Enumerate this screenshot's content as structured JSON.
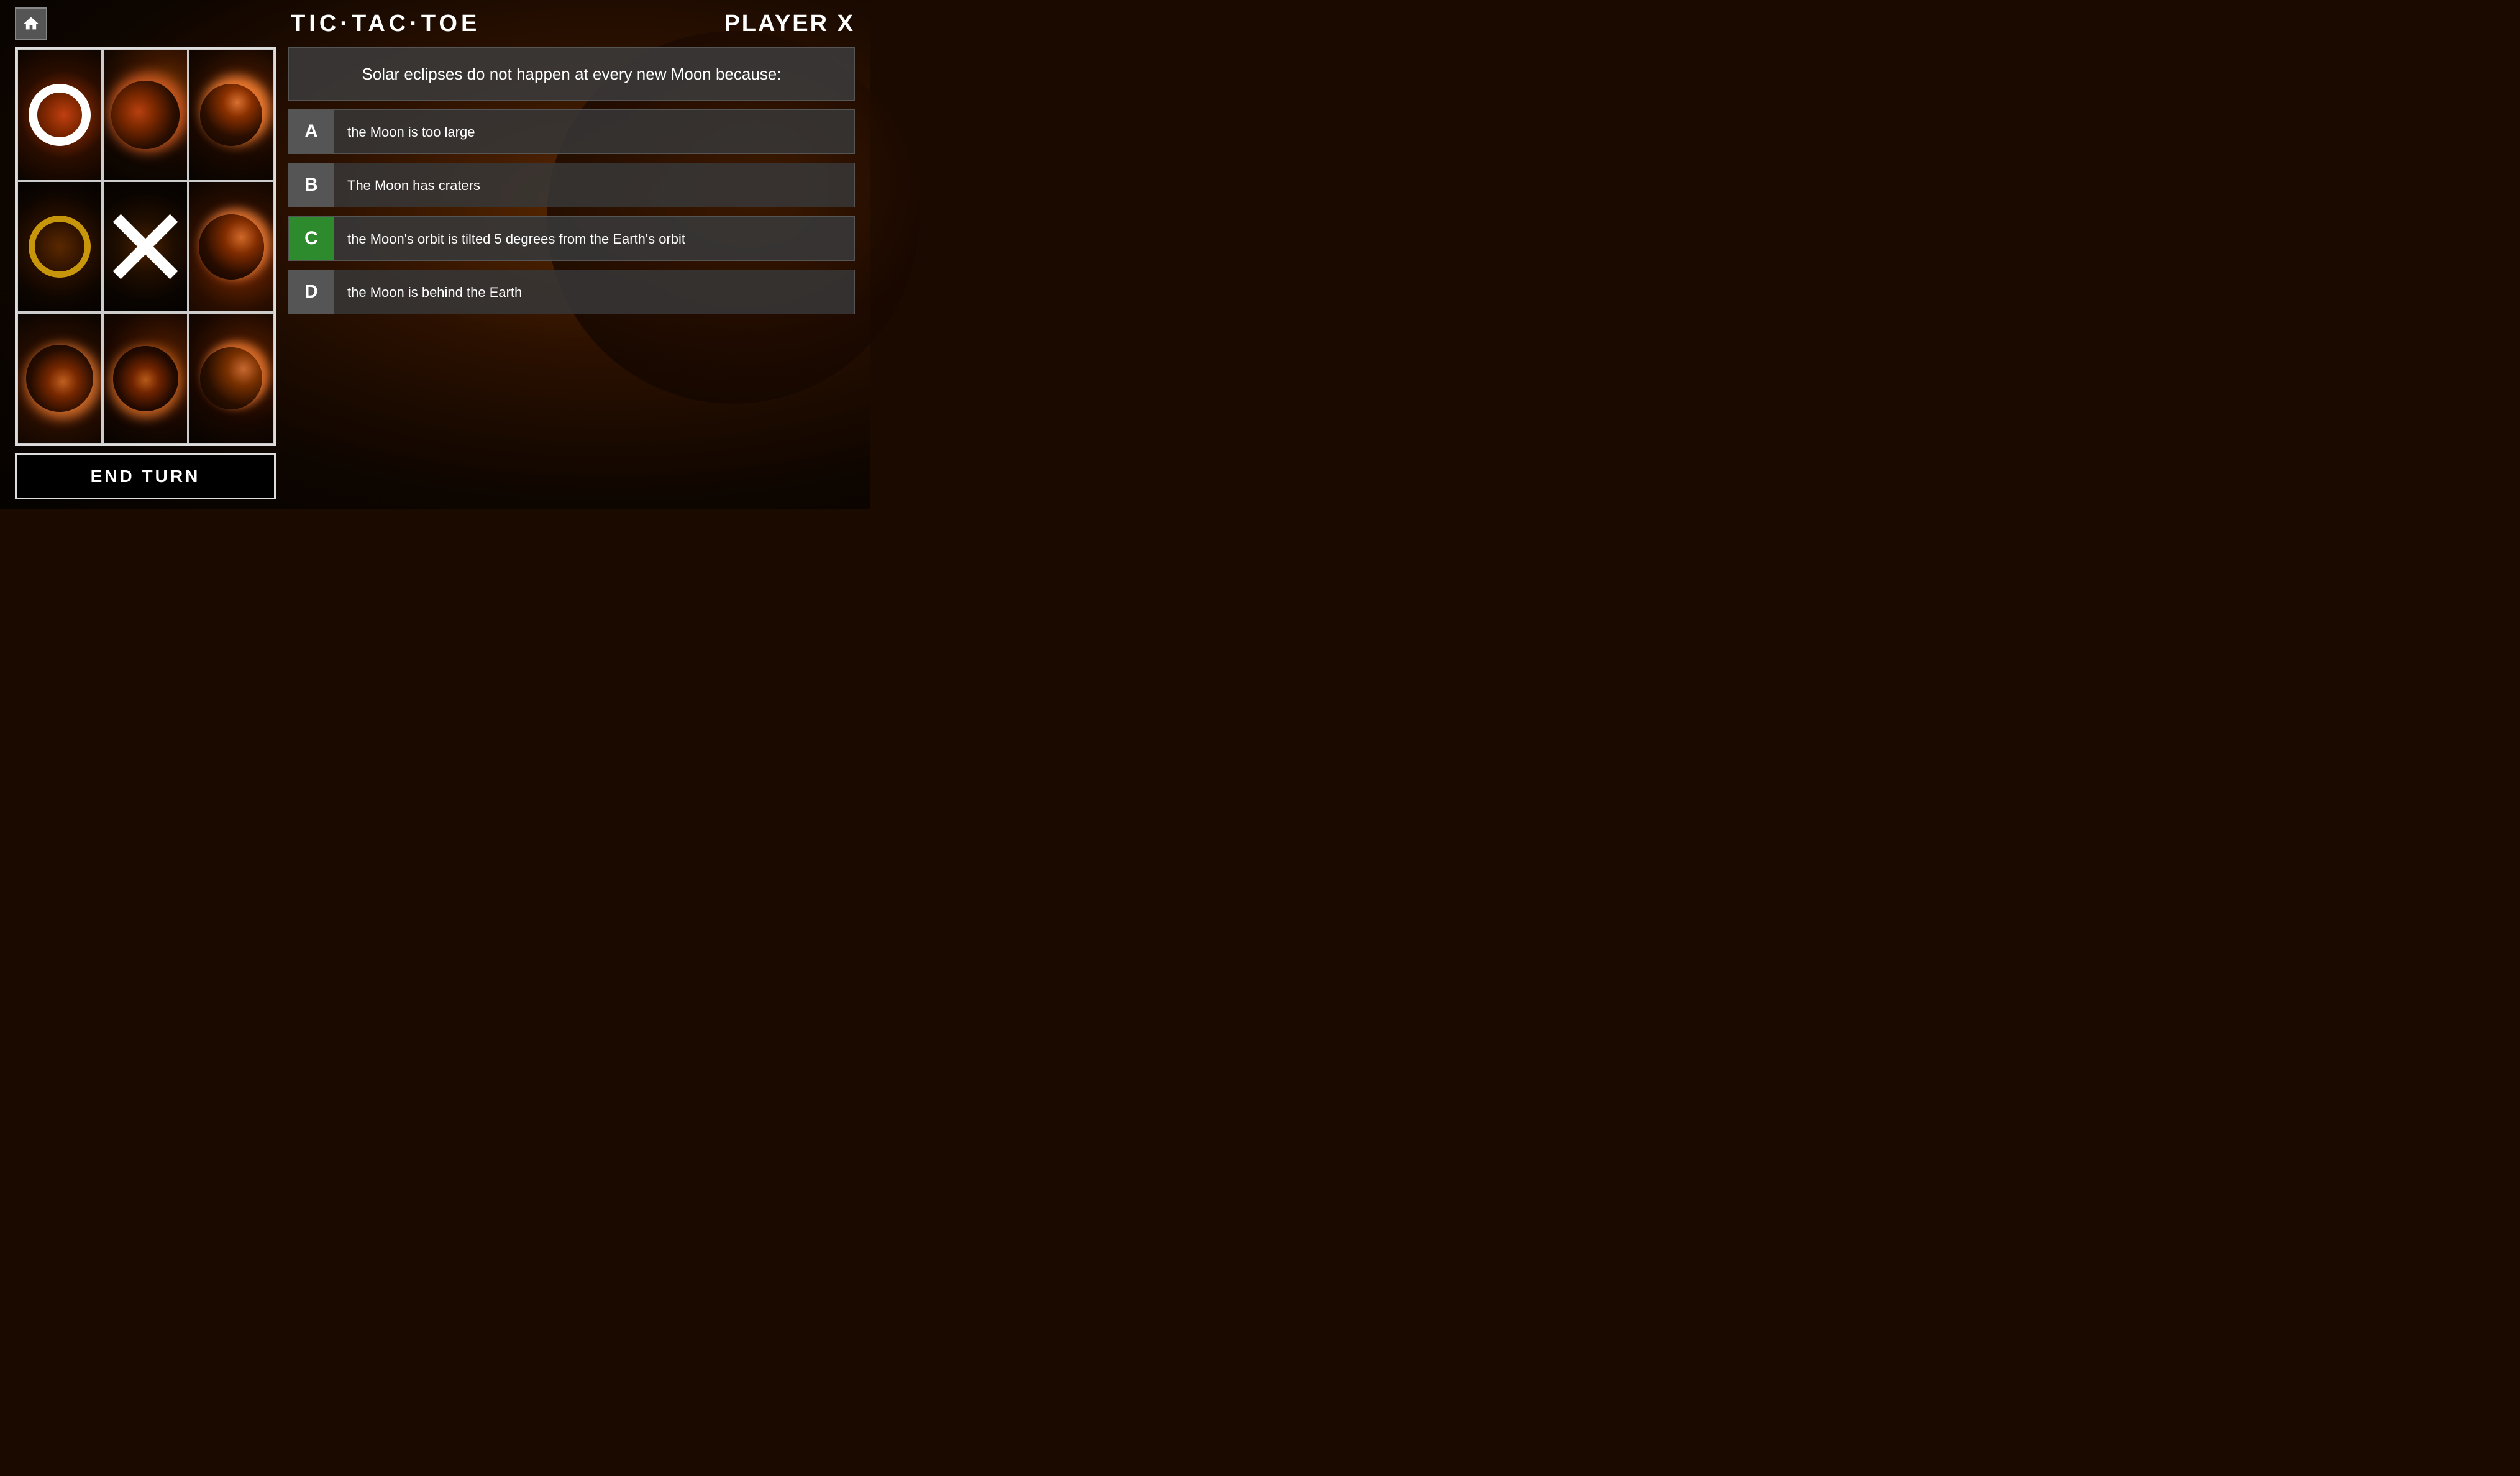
{
  "header": {
    "title": "TIC·TAC·TOE",
    "home_label": "home",
    "player_label": "PLAYER X"
  },
  "board": {
    "cells": [
      {
        "id": 1,
        "mark": "O_white"
      },
      {
        "id": 2,
        "mark": "none"
      },
      {
        "id": 3,
        "mark": "none"
      },
      {
        "id": 4,
        "mark": "O_gold"
      },
      {
        "id": 5,
        "mark": "X"
      },
      {
        "id": 6,
        "mark": "none"
      },
      {
        "id": 7,
        "mark": "none"
      },
      {
        "id": 8,
        "mark": "none"
      },
      {
        "id": 9,
        "mark": "none"
      }
    ]
  },
  "end_turn_button": "END TURN",
  "question": {
    "text": "Solar eclipses do not happen at every new Moon because:",
    "options": [
      {
        "letter": "A",
        "text": "the Moon is too large",
        "selected": false
      },
      {
        "letter": "B",
        "text": "The Moon has craters",
        "selected": false
      },
      {
        "letter": "C",
        "text": "the Moon's orbit is tilted 5 degrees from the Earth's orbit",
        "selected": true
      },
      {
        "letter": "D",
        "text": "the Moon is behind the Earth",
        "selected": false
      }
    ]
  }
}
